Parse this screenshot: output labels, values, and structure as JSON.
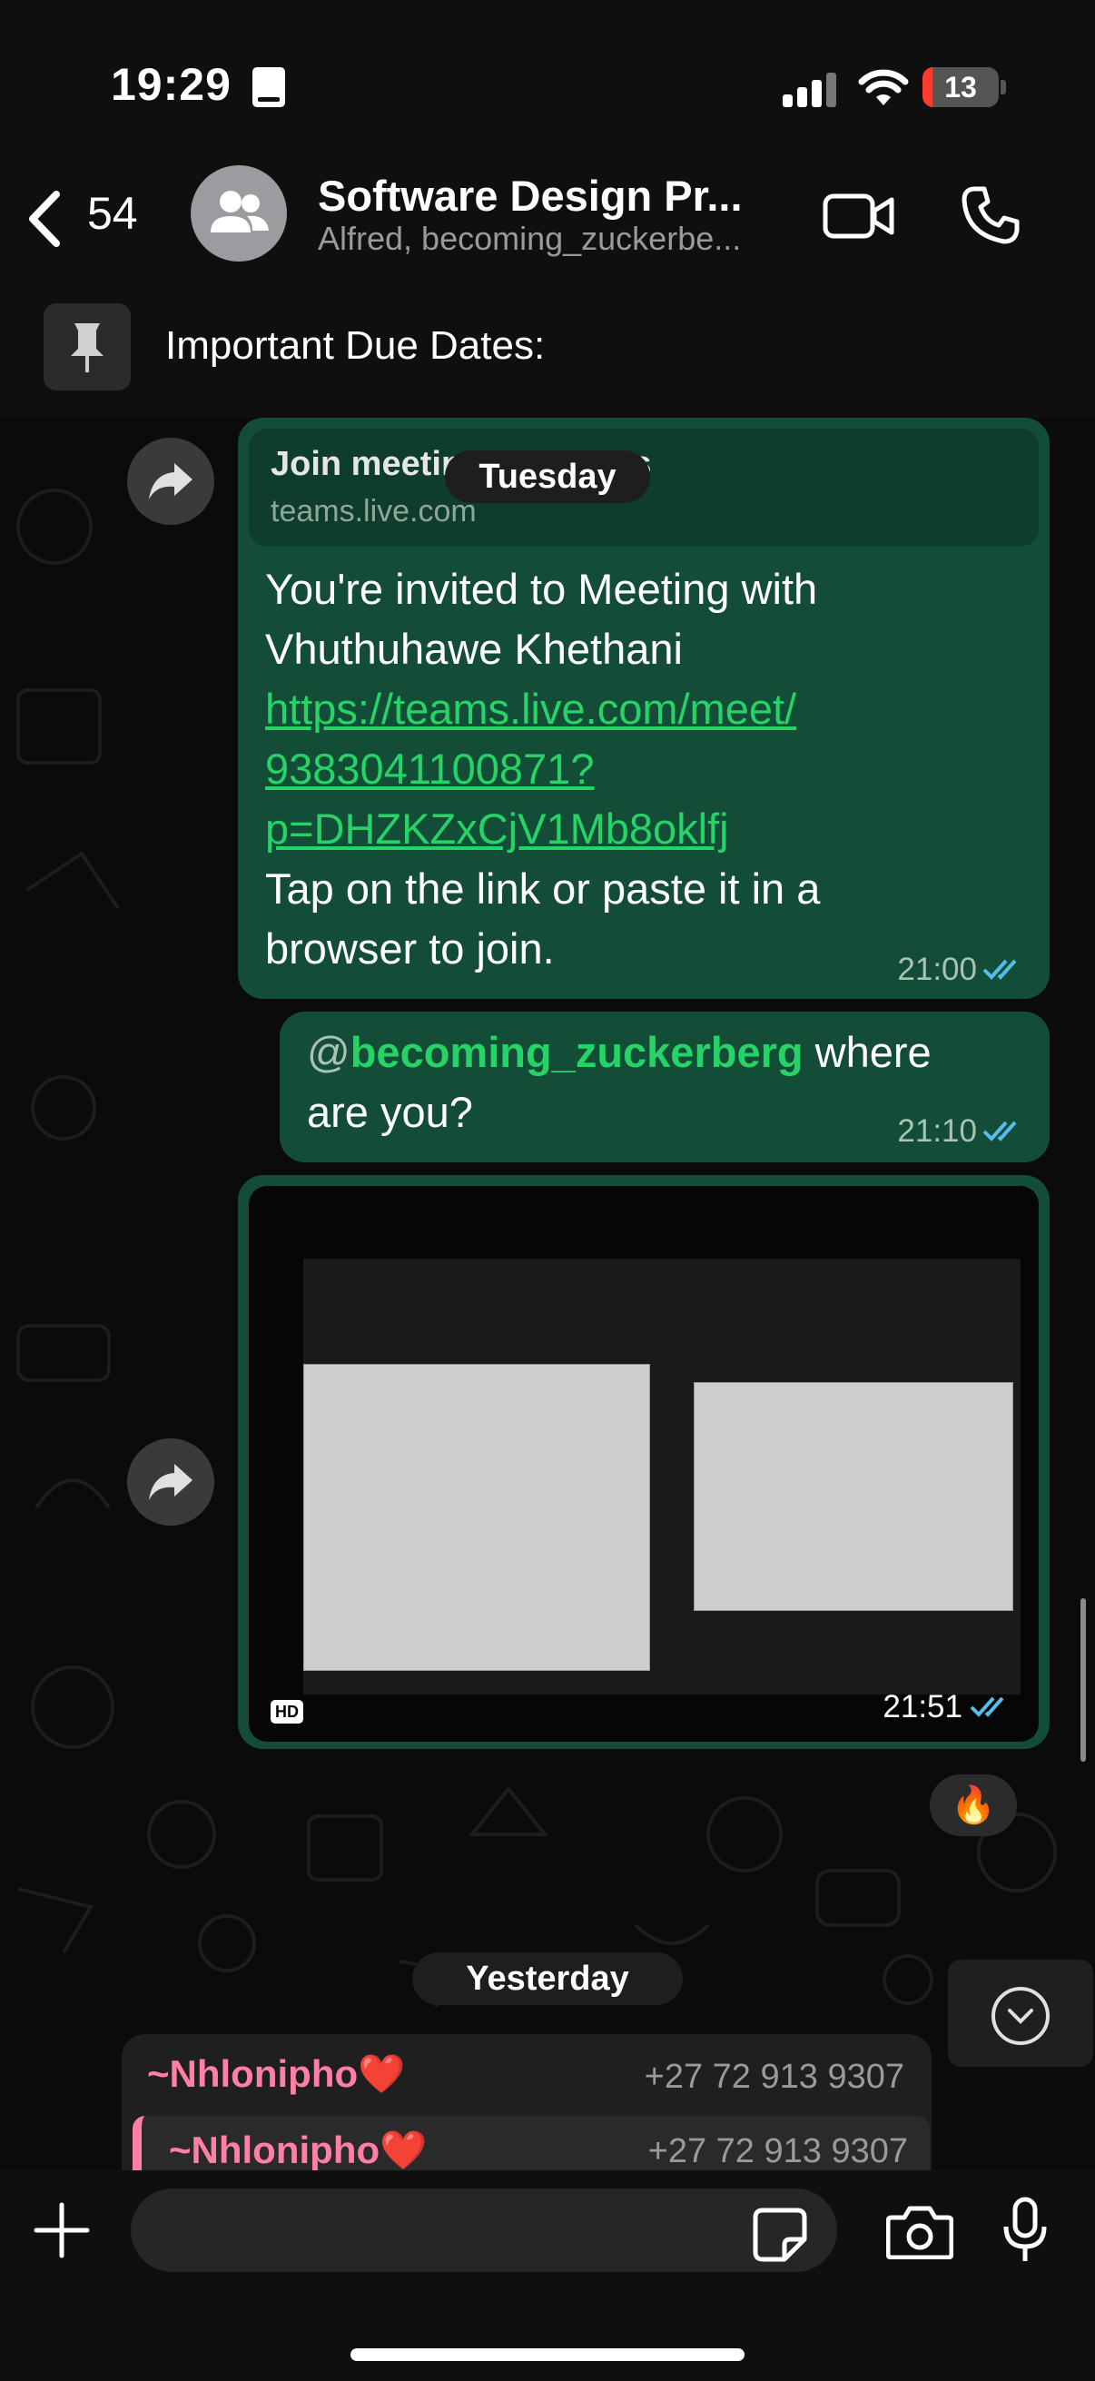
{
  "status_bar": {
    "time": "19:29",
    "battery": "13",
    "battery_level": 0.13
  },
  "header": {
    "back_count": "54",
    "title": "Software Design Pr...",
    "subtitle": "Alfred, becoming_zuckerbe..."
  },
  "pinned": {
    "text": "Important Due Dates:"
  },
  "messages": {
    "link_preview": {
      "title": "Join meeting on Teams",
      "host": "teams.live.com"
    },
    "date_tuesday": "Tuesday",
    "invite": {
      "line1": "You're invited to Meeting with",
      "line2": "Vhuthuhawe Khethani",
      "url1": "https://teams.live.com/meet/",
      "url2": "9383041100871?",
      "url3": "p=DHZKZxCjV1Mb8oklfj",
      "line3": "Tap on the link or paste it in a",
      "line4": "browser to join.",
      "time": "21:00"
    },
    "mention_msg": {
      "at": "@",
      "mention": "becoming_zuckerberg",
      "rest1": " where",
      "rest2": "are you?",
      "time": "21:10"
    },
    "photo": {
      "hd": "HD",
      "time": "21:51",
      "reaction": "🔥"
    },
    "date_yesterday": "Yesterday",
    "reply_msg": {
      "sender": "~Nhlonipho❤️",
      "phone": "+27 72 913 9307",
      "quoted_sender": "~Nhlonipho❤️",
      "quoted_phone": "+27 72 913 9307"
    }
  },
  "composer": {
    "placeholder": ""
  },
  "colors": {
    "bubble_out": "#144d37",
    "link": "#25d366",
    "sender": "#ff7fa5"
  }
}
